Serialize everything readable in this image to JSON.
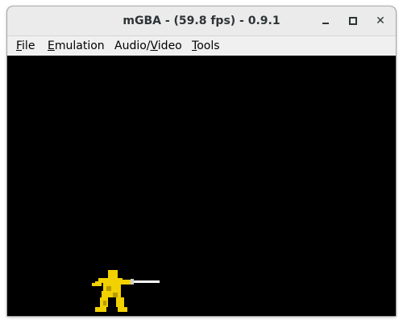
{
  "window": {
    "title": "mGBA -  (59.8 fps) - 0.9.1"
  },
  "menubar": {
    "items": [
      {
        "label": "File",
        "mnemonic": "F",
        "rest": "ile"
      },
      {
        "label": "Emulation",
        "mnemonic": "E",
        "rest": "mulation"
      },
      {
        "label": "Audio/Video",
        "pre": "Audio/",
        "mnemonic": "V",
        "rest": "ideo"
      },
      {
        "label": "Tools",
        "mnemonic": "T",
        "rest": "ools"
      }
    ]
  },
  "colors": {
    "screen_background": "#000000",
    "sprite_body": "#f2d100",
    "sprite_shadow": "#b89a00",
    "sword": "#ffffff"
  },
  "icons": {
    "minimize": "minimize-icon",
    "maximize": "maximize-icon",
    "close": "close-icon"
  }
}
